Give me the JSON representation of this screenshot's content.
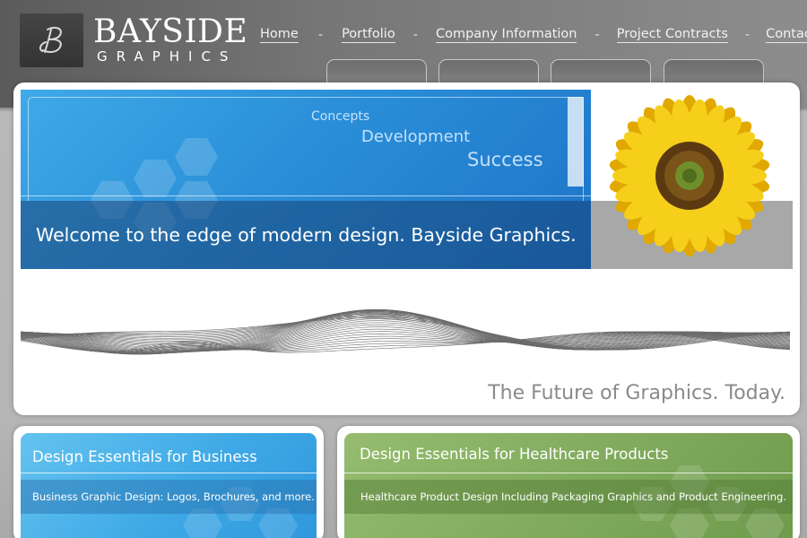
{
  "brand": {
    "title": "BAYSIDE",
    "subtitle": "GRAPHICS"
  },
  "nav": {
    "items": [
      "Home",
      "Portfolio",
      "Company Information",
      "Project Contracts",
      "Contact Us"
    ],
    "separator": "-"
  },
  "hero": {
    "words": [
      "Concepts",
      "Development",
      "Success"
    ],
    "welcome": "Welcome to the edge of modern design. Bayside Graphics."
  },
  "tagline": "The Future of Graphics. Today.",
  "panels": {
    "business": {
      "title": "Design Essentials for Business",
      "subtitle": "Business Graphic Design: Logos, Brochures, and more."
    },
    "healthcare": {
      "title": "Design Essentials for Healthcare Products",
      "subtitle": "Healthcare Product Design Including Packaging Graphics and Product Engineering."
    }
  },
  "colors": {
    "header": "#6e6e6e",
    "hero_blue": "#2a8fd8",
    "business_blue": "#3fa9e6",
    "health_green": "#7ea85a",
    "flower_yellow": "#f2c200"
  }
}
